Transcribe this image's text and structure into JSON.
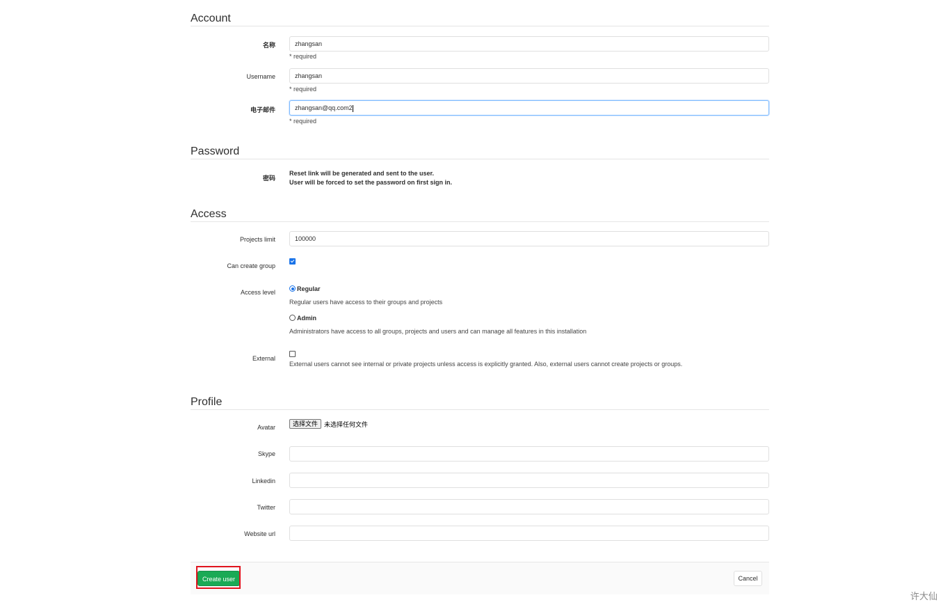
{
  "account": {
    "title": "Account",
    "name_label": "名称",
    "name_value": "zhangsan",
    "name_hint": "* required",
    "username_label": "Username",
    "username_value": "zhangsan",
    "username_hint": "* required",
    "email_label": "电子邮件",
    "email_value": "zhangsan@qq.com2",
    "email_hint": "* required"
  },
  "password": {
    "title": "Password",
    "label": "密码",
    "line1": "Reset link will be generated and sent to the user.",
    "line2": "User will be forced to set the password on first sign in."
  },
  "access": {
    "title": "Access",
    "projects_limit_label": "Projects limit",
    "projects_limit_value": "100000",
    "can_create_group_label": "Can create group",
    "can_create_group_checked": true,
    "access_level_label": "Access level",
    "regular_label": "Regular",
    "regular_desc": "Regular users have access to their groups and projects",
    "admin_label": "Admin",
    "admin_desc": "Administrators have access to all groups, projects and users and can manage all features in this installation",
    "selected_level": "Regular",
    "external_label": "External",
    "external_checked": false,
    "external_desc": "External users cannot see internal or private projects unless access is explicitly granted. Also, external users cannot create projects or groups."
  },
  "profile": {
    "title": "Profile",
    "avatar_label": "Avatar",
    "file_button": "选择文件",
    "file_status": "未选择任何文件",
    "skype_label": "Skype",
    "skype_value": "",
    "linkedin_label": "Linkedin",
    "linkedin_value": "",
    "twitter_label": "Twitter",
    "twitter_value": "",
    "website_label": "Website url",
    "website_value": ""
  },
  "footer": {
    "create_label": "Create user",
    "cancel_label": "Cancel"
  },
  "watermark": "许大仙",
  "colors": {
    "primary_green": "#1aaa55",
    "highlight_red": "#e0141e",
    "focus_blue": "#80bdff"
  }
}
